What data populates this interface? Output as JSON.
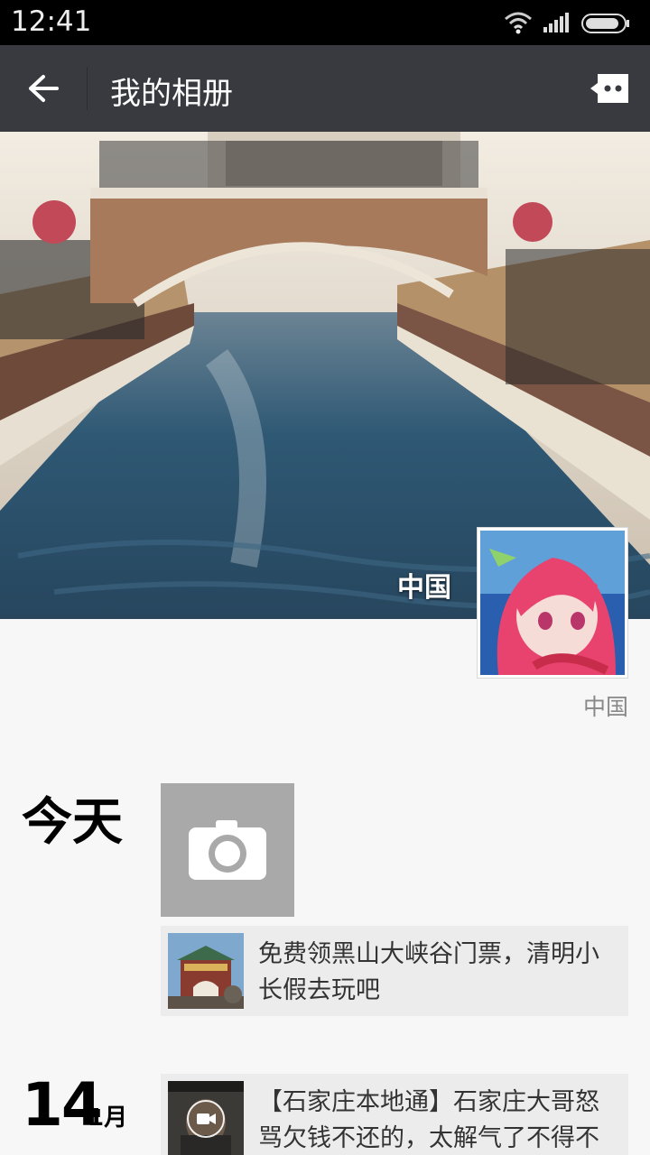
{
  "status_bar": {
    "time": "12:41"
  },
  "header": {
    "title": "我的相册"
  },
  "cover": {
    "location": "中国"
  },
  "profile": {
    "location": "中国"
  },
  "timeline": [
    {
      "day_label": "今天",
      "share_text": "免费领黑山大峡谷门票，清明小长假去玩吧"
    },
    {
      "day": "14",
      "month": "1月",
      "share_text": "【石家庄本地通】石家庄大哥怒骂欠钱不还的，太解气了不得不"
    }
  ],
  "colors": {
    "title_bar": "#393a3f",
    "status_bar": "#000000",
    "background": "#f7f7f7",
    "card": "#ececec"
  }
}
